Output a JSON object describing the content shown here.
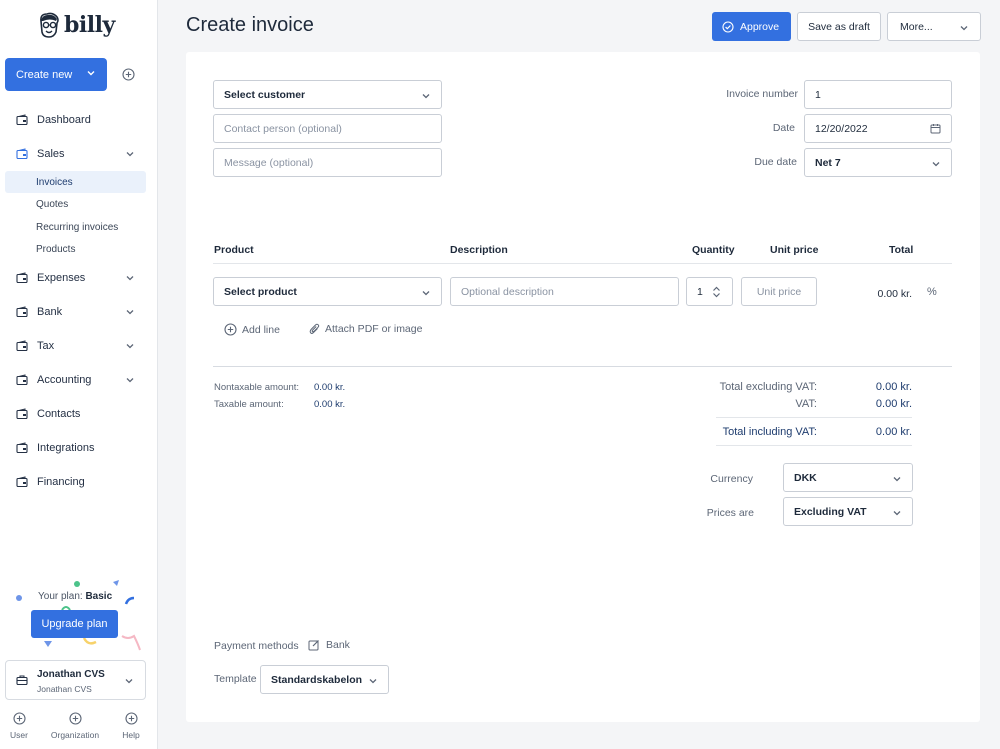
{
  "app": {
    "brand": "billy"
  },
  "sidebar": {
    "create_label": "Create new",
    "nav": [
      {
        "label": "Dashboard",
        "icon": "dashboard-icon",
        "has_chevron": false
      },
      {
        "label": "Sales",
        "icon": "sales-icon",
        "has_chevron": true
      },
      {
        "label": "Expenses",
        "icon": "expenses-icon",
        "has_chevron": true
      },
      {
        "label": "Bank",
        "icon": "bank-icon",
        "has_chevron": true
      },
      {
        "label": "Tax",
        "icon": "tax-icon",
        "has_chevron": true
      },
      {
        "label": "Accounting",
        "icon": "accounting-icon",
        "has_chevron": true
      },
      {
        "label": "Contacts",
        "icon": "contacts-icon",
        "has_chevron": false
      },
      {
        "label": "Integrations",
        "icon": "integrations-icon",
        "has_chevron": false
      },
      {
        "label": "Financing",
        "icon": "financing-icon",
        "has_chevron": false
      }
    ],
    "sales_sub": [
      {
        "label": "Invoices",
        "active": true
      },
      {
        "label": "Quotes",
        "active": false
      },
      {
        "label": "Recurring invoices",
        "active": false
      },
      {
        "label": "Products",
        "active": false
      }
    ],
    "plan_prefix": "Your plan:",
    "plan_name": "Basic",
    "upgrade_label": "Upgrade plan",
    "org_name": "Jonathan CVS",
    "org_sub": "Jonathan CVS",
    "bottom": [
      {
        "label": "User"
      },
      {
        "label": "Organization"
      },
      {
        "label": "Help"
      }
    ]
  },
  "header": {
    "title": "Create invoice",
    "approve_label": "Approve",
    "draft_label": "Save as draft",
    "more_label": "More..."
  },
  "form": {
    "customer_select": "Select customer",
    "contact_placeholder": "Contact person (optional)",
    "message_placeholder": "Message (optional)",
    "invoice_number_label": "Invoice number",
    "invoice_number_value": "1",
    "date_label": "Date",
    "date_value": "12/20/2022",
    "due_label": "Due date",
    "due_value": "Net 7"
  },
  "lines": {
    "headers": {
      "product": "Product",
      "description": "Description",
      "quantity": "Quantity",
      "unit_price": "Unit price",
      "total": "Total"
    },
    "row": {
      "product_select": "Select product",
      "description_placeholder": "Optional description",
      "quantity": "1",
      "unit_price_placeholder": "Unit price",
      "total": "0.00 kr.",
      "discount_symbol": "%"
    },
    "add_line": "Add line",
    "attach": "Attach PDF or image"
  },
  "summary": {
    "nontaxable_label": "Nontaxable amount:",
    "nontaxable_value": "0.00 kr.",
    "taxable_label": "Taxable amount:",
    "taxable_value": "0.00 kr.",
    "excl_label": "Total excluding VAT:",
    "excl_value": "0.00 kr.",
    "vat_label": "VAT:",
    "vat_value": "0.00 kr.",
    "incl_label": "Total including VAT:",
    "incl_value": "0.00 kr.",
    "currency_label": "Currency",
    "currency_value": "DKK",
    "prices_label": "Prices are",
    "prices_value": "Excluding VAT"
  },
  "footer": {
    "payment_label": "Payment methods",
    "payment_value": "Bank",
    "template_label": "Template",
    "template_value": "Standardskabelon"
  },
  "colors": {
    "accent": "#3370e0",
    "text": "#1e2a3b",
    "muted": "#5c6676"
  }
}
